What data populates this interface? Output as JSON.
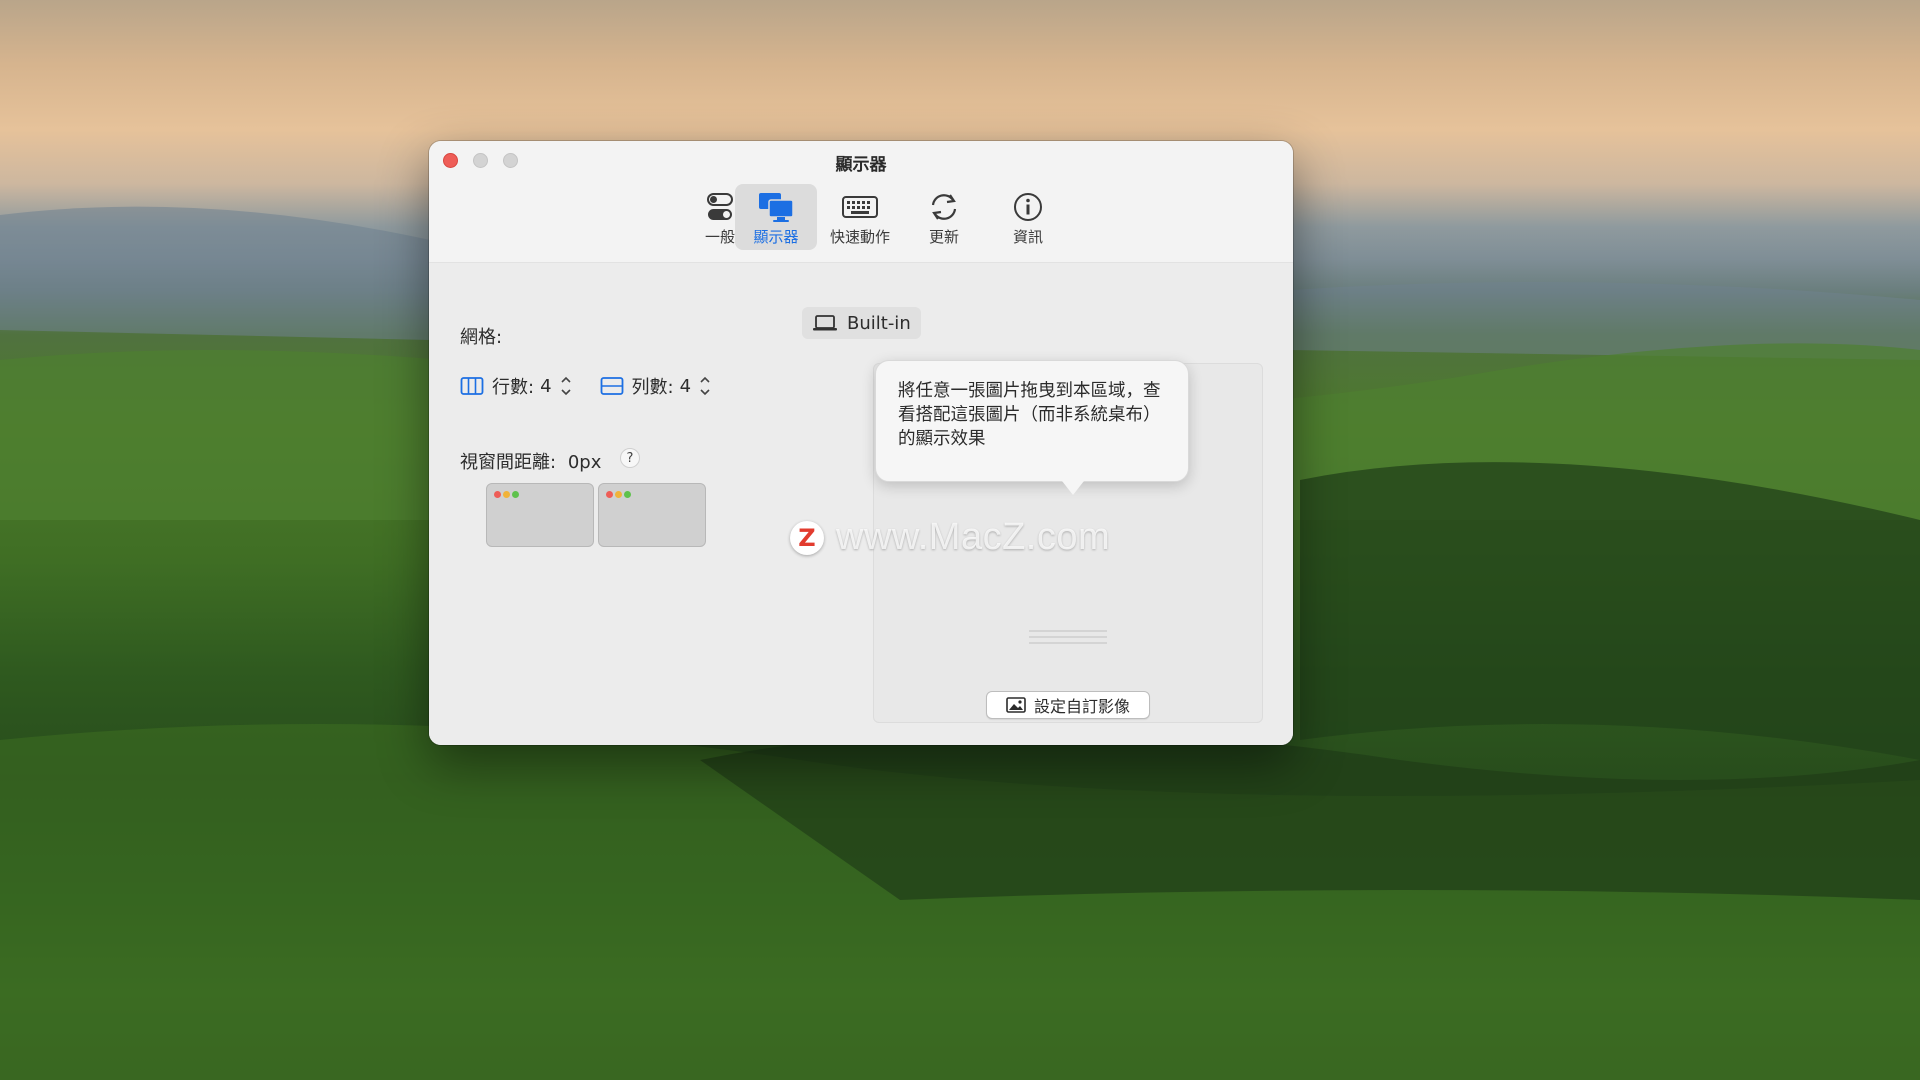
{
  "window": {
    "title": "顯示器"
  },
  "tabs": [
    {
      "label": "一般",
      "icon": "toggles-icon",
      "selected": false
    },
    {
      "label": "顯示器",
      "icon": "displays-icon",
      "selected": true
    },
    {
      "label": "快速動作",
      "icon": "keyboard-icon",
      "selected": false
    },
    {
      "label": "更新",
      "icon": "refresh-icon",
      "selected": false
    },
    {
      "label": "資訊",
      "icon": "info-icon",
      "selected": false
    }
  ],
  "display": {
    "name": "Built-in"
  },
  "grid": {
    "label": "網格:",
    "rows_label": "行數:",
    "rows_value": "4",
    "cols_label": "列數:",
    "cols_value": "4"
  },
  "gap": {
    "label": "視窗間距離:",
    "value": "0px",
    "help": "?"
  },
  "preview": {
    "tooltip": "將任意一張圖片拖曳到本區域，查看搭配這張圖片（而非系統桌布）的顯示效果",
    "custom_button": "設定自訂影像"
  },
  "watermark": {
    "logo": "Z",
    "text": "www.MacZ.com"
  },
  "colors": {
    "accent": "#1c6fe3",
    "close": "#ee5d57"
  }
}
